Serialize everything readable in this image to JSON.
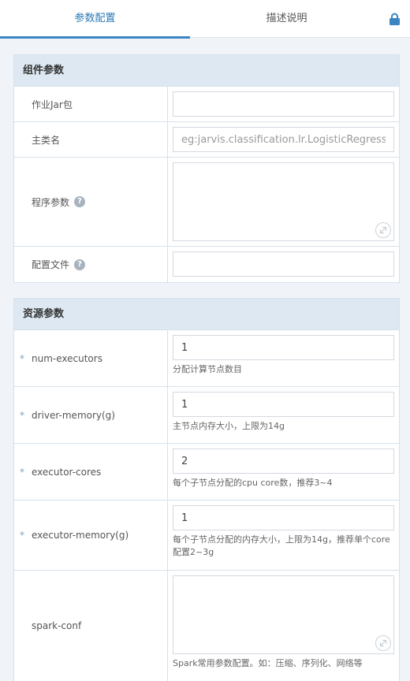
{
  "tabs": {
    "params": "参数配置",
    "description": "描述说明"
  },
  "component_panel": {
    "title": "组件参数",
    "rows": {
      "jar": {
        "label": "作业Jar包",
        "value": ""
      },
      "main_class": {
        "label": "主类名",
        "placeholder": "eg:jarvis.classification.lr.LogisticRegression"
      },
      "program_args": {
        "label": "程序参数",
        "help": "?"
      },
      "config_file": {
        "label": "配置文件",
        "help": "?"
      }
    }
  },
  "resource_panel": {
    "title": "资源参数",
    "rows": {
      "num_executors": {
        "star": "*",
        "label": "num-executors",
        "value": "1",
        "hint": "分配计算节点数目"
      },
      "driver_memory": {
        "star": "*",
        "label": "driver-memory(g)",
        "value": "1",
        "hint": "主节点内存大小，上限为14g"
      },
      "executor_cores": {
        "star": "*",
        "label": "executor-cores",
        "value": "2",
        "hint": "每个子节点分配的cpu core数，推荐3~4"
      },
      "executor_memory": {
        "star": "*",
        "label": "executor-memory(g)",
        "value": "1",
        "hint": "每个子节点分配的内存大小，上限为14g，推荐单个core配置2~3g"
      },
      "spark_conf": {
        "label": "spark-conf",
        "hint": "Spark常用参数配置。如：压缩、序列化、网络等"
      }
    }
  },
  "icons": {
    "lock": "lock-icon",
    "help": "question-circle-icon",
    "resize": "expand-icon"
  },
  "colors": {
    "accent": "#3a85c2",
    "header_bg": "#dde8f3",
    "page_bg": "#f0f4f8"
  }
}
